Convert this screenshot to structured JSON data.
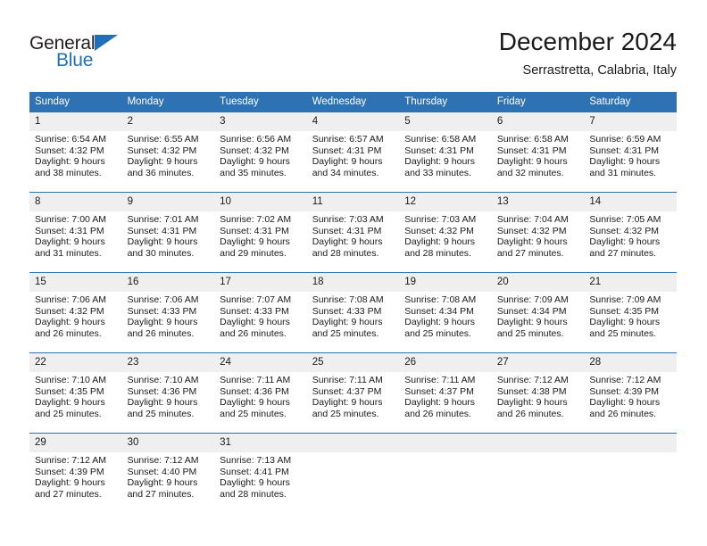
{
  "brand": {
    "name_part1": "General",
    "name_part2": "Blue",
    "accent_color": "#1f70b8"
  },
  "header": {
    "title": "December 2024",
    "subtitle": "Serrastretta, Calabria, Italy"
  },
  "calendar": {
    "header_color": "#2f72b4",
    "daynum_band_color": "#efefef",
    "weekday_headers": [
      "Sunday",
      "Monday",
      "Tuesday",
      "Wednesday",
      "Thursday",
      "Friday",
      "Saturday"
    ],
    "weeks": [
      [
        {
          "day": "1",
          "sunrise": "Sunrise: 6:54 AM",
          "sunset": "Sunset: 4:32 PM",
          "daylight_line1": "Daylight: 9 hours",
          "daylight_line2": "and 38 minutes."
        },
        {
          "day": "2",
          "sunrise": "Sunrise: 6:55 AM",
          "sunset": "Sunset: 4:32 PM",
          "daylight_line1": "Daylight: 9 hours",
          "daylight_line2": "and 36 minutes."
        },
        {
          "day": "3",
          "sunrise": "Sunrise: 6:56 AM",
          "sunset": "Sunset: 4:32 PM",
          "daylight_line1": "Daylight: 9 hours",
          "daylight_line2": "and 35 minutes."
        },
        {
          "day": "4",
          "sunrise": "Sunrise: 6:57 AM",
          "sunset": "Sunset: 4:31 PM",
          "daylight_line1": "Daylight: 9 hours",
          "daylight_line2": "and 34 minutes."
        },
        {
          "day": "5",
          "sunrise": "Sunrise: 6:58 AM",
          "sunset": "Sunset: 4:31 PM",
          "daylight_line1": "Daylight: 9 hours",
          "daylight_line2": "and 33 minutes."
        },
        {
          "day": "6",
          "sunrise": "Sunrise: 6:58 AM",
          "sunset": "Sunset: 4:31 PM",
          "daylight_line1": "Daylight: 9 hours",
          "daylight_line2": "and 32 minutes."
        },
        {
          "day": "7",
          "sunrise": "Sunrise: 6:59 AM",
          "sunset": "Sunset: 4:31 PM",
          "daylight_line1": "Daylight: 9 hours",
          "daylight_line2": "and 31 minutes."
        }
      ],
      [
        {
          "day": "8",
          "sunrise": "Sunrise: 7:00 AM",
          "sunset": "Sunset: 4:31 PM",
          "daylight_line1": "Daylight: 9 hours",
          "daylight_line2": "and 31 minutes."
        },
        {
          "day": "9",
          "sunrise": "Sunrise: 7:01 AM",
          "sunset": "Sunset: 4:31 PM",
          "daylight_line1": "Daylight: 9 hours",
          "daylight_line2": "and 30 minutes."
        },
        {
          "day": "10",
          "sunrise": "Sunrise: 7:02 AM",
          "sunset": "Sunset: 4:31 PM",
          "daylight_line1": "Daylight: 9 hours",
          "daylight_line2": "and 29 minutes."
        },
        {
          "day": "11",
          "sunrise": "Sunrise: 7:03 AM",
          "sunset": "Sunset: 4:31 PM",
          "daylight_line1": "Daylight: 9 hours",
          "daylight_line2": "and 28 minutes."
        },
        {
          "day": "12",
          "sunrise": "Sunrise: 7:03 AM",
          "sunset": "Sunset: 4:32 PM",
          "daylight_line1": "Daylight: 9 hours",
          "daylight_line2": "and 28 minutes."
        },
        {
          "day": "13",
          "sunrise": "Sunrise: 7:04 AM",
          "sunset": "Sunset: 4:32 PM",
          "daylight_line1": "Daylight: 9 hours",
          "daylight_line2": "and 27 minutes."
        },
        {
          "day": "14",
          "sunrise": "Sunrise: 7:05 AM",
          "sunset": "Sunset: 4:32 PM",
          "daylight_line1": "Daylight: 9 hours",
          "daylight_line2": "and 27 minutes."
        }
      ],
      [
        {
          "day": "15",
          "sunrise": "Sunrise: 7:06 AM",
          "sunset": "Sunset: 4:32 PM",
          "daylight_line1": "Daylight: 9 hours",
          "daylight_line2": "and 26 minutes."
        },
        {
          "day": "16",
          "sunrise": "Sunrise: 7:06 AM",
          "sunset": "Sunset: 4:33 PM",
          "daylight_line1": "Daylight: 9 hours",
          "daylight_line2": "and 26 minutes."
        },
        {
          "day": "17",
          "sunrise": "Sunrise: 7:07 AM",
          "sunset": "Sunset: 4:33 PM",
          "daylight_line1": "Daylight: 9 hours",
          "daylight_line2": "and 26 minutes."
        },
        {
          "day": "18",
          "sunrise": "Sunrise: 7:08 AM",
          "sunset": "Sunset: 4:33 PM",
          "daylight_line1": "Daylight: 9 hours",
          "daylight_line2": "and 25 minutes."
        },
        {
          "day": "19",
          "sunrise": "Sunrise: 7:08 AM",
          "sunset": "Sunset: 4:34 PM",
          "daylight_line1": "Daylight: 9 hours",
          "daylight_line2": "and 25 minutes."
        },
        {
          "day": "20",
          "sunrise": "Sunrise: 7:09 AM",
          "sunset": "Sunset: 4:34 PM",
          "daylight_line1": "Daylight: 9 hours",
          "daylight_line2": "and 25 minutes."
        },
        {
          "day": "21",
          "sunrise": "Sunrise: 7:09 AM",
          "sunset": "Sunset: 4:35 PM",
          "daylight_line1": "Daylight: 9 hours",
          "daylight_line2": "and 25 minutes."
        }
      ],
      [
        {
          "day": "22",
          "sunrise": "Sunrise: 7:10 AM",
          "sunset": "Sunset: 4:35 PM",
          "daylight_line1": "Daylight: 9 hours",
          "daylight_line2": "and 25 minutes."
        },
        {
          "day": "23",
          "sunrise": "Sunrise: 7:10 AM",
          "sunset": "Sunset: 4:36 PM",
          "daylight_line1": "Daylight: 9 hours",
          "daylight_line2": "and 25 minutes."
        },
        {
          "day": "24",
          "sunrise": "Sunrise: 7:11 AM",
          "sunset": "Sunset: 4:36 PM",
          "daylight_line1": "Daylight: 9 hours",
          "daylight_line2": "and 25 minutes."
        },
        {
          "day": "25",
          "sunrise": "Sunrise: 7:11 AM",
          "sunset": "Sunset: 4:37 PM",
          "daylight_line1": "Daylight: 9 hours",
          "daylight_line2": "and 25 minutes."
        },
        {
          "day": "26",
          "sunrise": "Sunrise: 7:11 AM",
          "sunset": "Sunset: 4:37 PM",
          "daylight_line1": "Daylight: 9 hours",
          "daylight_line2": "and 26 minutes."
        },
        {
          "day": "27",
          "sunrise": "Sunrise: 7:12 AM",
          "sunset": "Sunset: 4:38 PM",
          "daylight_line1": "Daylight: 9 hours",
          "daylight_line2": "and 26 minutes."
        },
        {
          "day": "28",
          "sunrise": "Sunrise: 7:12 AM",
          "sunset": "Sunset: 4:39 PM",
          "daylight_line1": "Daylight: 9 hours",
          "daylight_line2": "and 26 minutes."
        }
      ],
      [
        {
          "day": "29",
          "sunrise": "Sunrise: 7:12 AM",
          "sunset": "Sunset: 4:39 PM",
          "daylight_line1": "Daylight: 9 hours",
          "daylight_line2": "and 27 minutes."
        },
        {
          "day": "30",
          "sunrise": "Sunrise: 7:12 AM",
          "sunset": "Sunset: 4:40 PM",
          "daylight_line1": "Daylight: 9 hours",
          "daylight_line2": "and 27 minutes."
        },
        {
          "day": "31",
          "sunrise": "Sunrise: 7:13 AM",
          "sunset": "Sunset: 4:41 PM",
          "daylight_line1": "Daylight: 9 hours",
          "daylight_line2": "and 28 minutes."
        },
        {
          "day": "",
          "sunrise": "",
          "sunset": "",
          "daylight_line1": "",
          "daylight_line2": ""
        },
        {
          "day": "",
          "sunrise": "",
          "sunset": "",
          "daylight_line1": "",
          "daylight_line2": ""
        },
        {
          "day": "",
          "sunrise": "",
          "sunset": "",
          "daylight_line1": "",
          "daylight_line2": ""
        },
        {
          "day": "",
          "sunrise": "",
          "sunset": "",
          "daylight_line1": "",
          "daylight_line2": ""
        }
      ]
    ]
  }
}
